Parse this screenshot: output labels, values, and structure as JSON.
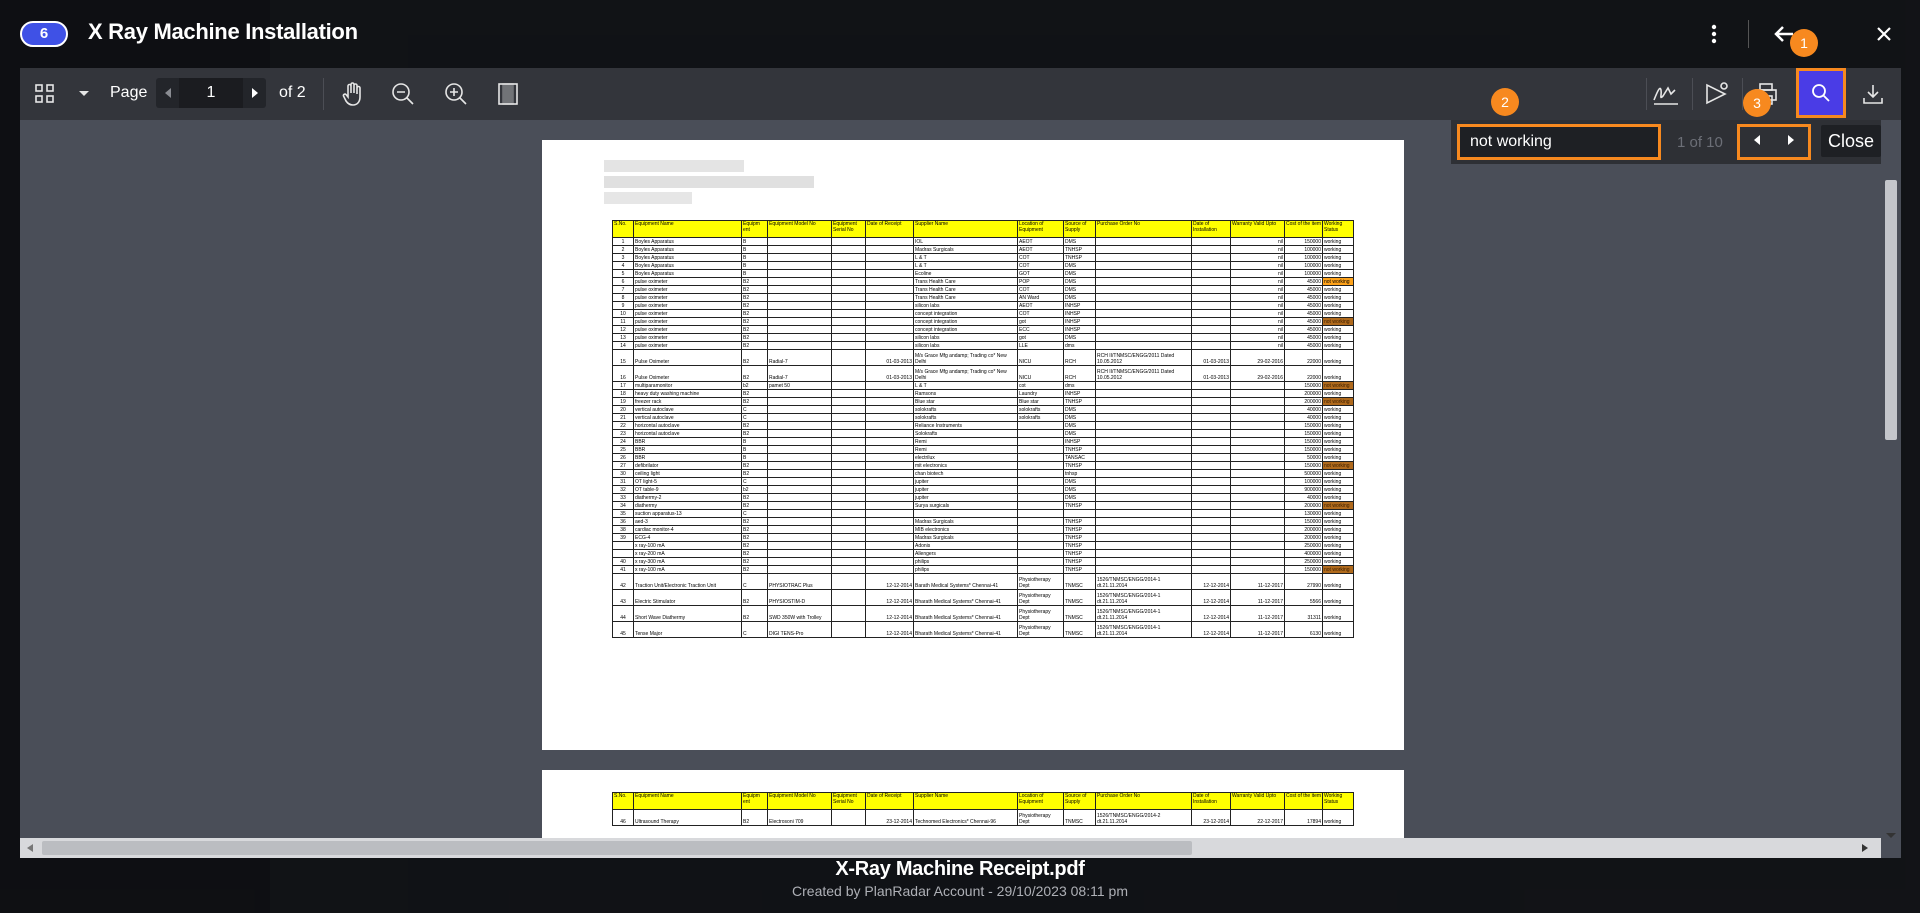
{
  "header": {
    "badge_count": "6",
    "title": "X Ray Machine Installation",
    "menu_icon": "kebab-icon",
    "back_icon": "arrow-left-icon",
    "close_icon": "close-icon"
  },
  "toolbar": {
    "page_label": "Page",
    "current_page": "1",
    "total_pages_label": "of 2",
    "icons": [
      "thumbnails-icon",
      "chevron-down-icon",
      "pan-hand-icon",
      "zoom-out-icon",
      "zoom-in-icon",
      "fit-page-icon",
      "signature-icon",
      "share-icon",
      "print-icon",
      "search-icon",
      "download-icon"
    ]
  },
  "search": {
    "query": "not working",
    "result_count": "1 of 10",
    "close_label": "Close"
  },
  "markers": [
    "1",
    "2",
    "3"
  ],
  "document": {
    "headers": [
      "S.No.",
      "Equipment Name",
      "Equipm ent",
      "Equipment Model No",
      "Equipment Serial No",
      "Date of Receipt",
      "Supplier Name",
      "Location of Equipment",
      "Source of Supply",
      "Purchase Order No",
      "Date of Installation",
      "Warranty Valid Upto",
      "Cost of the item",
      "Working Status"
    ],
    "rows": [
      [
        "1",
        "Boyles Apparatus",
        "B",
        "",
        "",
        "",
        "IOL",
        "AEOT",
        "DMS",
        "",
        "",
        "nil",
        "150000",
        "working"
      ],
      [
        "2",
        "Boyles Apparatus",
        "B",
        "",
        "",
        "",
        "Madras Surgicals",
        "AEOT",
        "TNHSP",
        "",
        "",
        "nil",
        "100000",
        "working"
      ],
      [
        "3",
        "Boyles Apparatus",
        "B",
        "",
        "",
        "",
        "L & T",
        "COT",
        "TNHSP",
        "",
        "",
        "nil",
        "100000",
        "working"
      ],
      [
        "4",
        "Boyles Apparatus",
        "B",
        "",
        "",
        "",
        "L & T",
        "COT",
        "DMS",
        "",
        "",
        "nil",
        "100000",
        "working"
      ],
      [
        "5",
        "Boyles Apparatus",
        "B",
        "",
        "",
        "",
        "Ecoline",
        "GOT",
        "DMS",
        "",
        "",
        "nil",
        "100000",
        "working"
      ],
      [
        "6",
        "pulse oximeter",
        "B2",
        "",
        "",
        "",
        "Trans Health Care",
        "POP",
        "DMS",
        "",
        "",
        "nil",
        "45000",
        "not working"
      ],
      [
        "7",
        "pulse oximeter",
        "B2",
        "",
        "",
        "",
        "Trans Health Care",
        "COT",
        "DMS",
        "",
        "",
        "nil",
        "45000",
        "working"
      ],
      [
        "8",
        "pulse oximeter",
        "B2",
        "",
        "",
        "",
        "Trans Health Care",
        "AN Ward",
        "DMS",
        "",
        "",
        "nil",
        "45000",
        "working"
      ],
      [
        "9",
        "pulse oximeter",
        "B2",
        "",
        "",
        "",
        "silicon labs",
        "AEOT",
        "INHSP",
        "",
        "",
        "nil",
        "45000",
        "working"
      ],
      [
        "10",
        "pulse oximeter",
        "B2",
        "",
        "",
        "",
        "concept integration",
        "COT",
        "INHSP",
        "",
        "",
        "nil",
        "45000",
        "working"
      ],
      [
        "11",
        "pulse oximeter",
        "B2",
        "",
        "",
        "",
        "concept integration",
        "got",
        "INHSP",
        "",
        "",
        "nil",
        "45000",
        "not working"
      ],
      [
        "12",
        "pulse oximeter",
        "B2",
        "",
        "",
        "",
        "concept integration",
        "ECC",
        "INHSP",
        "",
        "",
        "nil",
        "45000",
        "working"
      ],
      [
        "13",
        "pulse oximeter",
        "B2",
        "",
        "",
        "",
        "silicon labs",
        "got",
        "DMS",
        "",
        "",
        "nil",
        "45000",
        "working"
      ],
      [
        "14",
        "pulse oximeter",
        "B2",
        "",
        "",
        "",
        "silicon labs",
        "LLE",
        "dms",
        "",
        "",
        "nil",
        "45000",
        "working"
      ],
      [
        "15",
        "Pulse Oximeter",
        "B2",
        "Radial-7",
        "",
        "01-03-2013",
        "M/s Grace Mfg andamp; Trading co* New Delhi",
        "NICU",
        "RCH",
        "RCH II/TNMSC/ENGG/2011 Dated 10.05.2012",
        "01-03-2013",
        "29-02-2016",
        "22000",
        "working"
      ],
      [
        "16",
        "Pulse Oximeter",
        "B2",
        "Radial-7",
        "",
        "01-03-2013",
        "M/s Grace Mfg andamp; Trading co* New Delhi",
        "NICU",
        "RCH",
        "RCH II/TNMSC/ENGG/2011 Dated 10.05.2012",
        "01-03-2013",
        "29-02-2016",
        "22000",
        "working"
      ],
      [
        "17",
        "multiparamonitor",
        "b2",
        "pamet 50",
        "",
        "",
        "L & T",
        "cot",
        "dms",
        "",
        "",
        "",
        "150000",
        "not working"
      ],
      [
        "18",
        "heavy duty washing machine",
        "B2",
        "",
        "",
        "",
        "Ramsons",
        "Laundry",
        "INHSP",
        "",
        "",
        "",
        "200000",
        "working"
      ],
      [
        "19",
        "freezer rack",
        "B2",
        "",
        "",
        "",
        "Blue star",
        "Blue star",
        "TNHSP",
        "",
        "",
        "",
        "200000",
        "not working"
      ],
      [
        "20",
        "vertical autoclave",
        "C",
        "",
        "",
        "",
        "solokrafts",
        "solokrafts",
        "DMS",
        "",
        "",
        "",
        "40000",
        "working"
      ],
      [
        "21",
        "vertical autoclave",
        "C",
        "",
        "",
        "",
        "solokrafts",
        "solokrafts",
        "DMS",
        "",
        "",
        "",
        "40000",
        "working"
      ],
      [
        "22",
        "horizontal autoclave",
        "B2",
        "",
        "",
        "",
        "Reliance Instruments",
        "",
        "DMS",
        "",
        "",
        "",
        "150000",
        "working"
      ],
      [
        "23",
        "horizontal autoclave",
        "B2",
        "",
        "",
        "",
        "Solokrafts",
        "",
        "DMS",
        "",
        "",
        "",
        "150000",
        "working"
      ],
      [
        "24",
        "BBR",
        "B",
        "",
        "",
        "",
        "Remi",
        "",
        "INHSP",
        "",
        "",
        "",
        "150000",
        "working"
      ],
      [
        "25",
        "BBR",
        "B",
        "",
        "",
        "",
        "Remi",
        "",
        "TNHSP",
        "",
        "",
        "",
        "150000",
        "working"
      ],
      [
        "26",
        "BBR",
        "B",
        "",
        "",
        "",
        "electrilux",
        "",
        "TANSAC",
        "",
        "",
        "",
        "50000",
        "working"
      ],
      [
        "27",
        "defibrilator",
        "B2",
        "",
        "",
        "",
        "mit electronics",
        "",
        "TNHSP",
        "",
        "",
        "",
        "150000",
        "not working"
      ],
      [
        "30",
        "ceiling light",
        "B2",
        "",
        "",
        "",
        "chan biotech",
        "",
        "tnhsp",
        "",
        "",
        "",
        "500000",
        "working"
      ],
      [
        "31",
        "OT light-5",
        "C",
        "",
        "",
        "",
        "jupiter",
        "",
        "DMS",
        "",
        "",
        "",
        "100000",
        "working"
      ],
      [
        "32",
        "OT table-9",
        "b2",
        "",
        "",
        "",
        "jupiter",
        "",
        "DMS",
        "",
        "",
        "",
        "900000",
        "working"
      ],
      [
        "33",
        "diathermy-2",
        "B2",
        "",
        "",
        "",
        "jupiter",
        "",
        "DMS",
        "",
        "",
        "",
        "40000",
        "working"
      ],
      [
        "34",
        "diathermy",
        "B2",
        "",
        "",
        "",
        "Surya surgicals",
        "",
        "TNHSP",
        "",
        "",
        "",
        "200000",
        "not working"
      ],
      [
        "35",
        "suction apparatus-13",
        "C",
        "",
        "",
        "",
        "",
        "",
        "",
        "",
        "",
        "",
        "130000",
        "working"
      ],
      [
        "36",
        "aed-3",
        "B2",
        "",
        "",
        "",
        "Madras Surgicals",
        "",
        "TNHSP",
        "",
        "",
        "",
        "150000",
        "working"
      ],
      [
        "38",
        "cardiac monitor-4",
        "B2",
        "",
        "",
        "",
        "MIB electronics",
        "",
        "TNHSP",
        "",
        "",
        "",
        "200000",
        "working"
      ],
      [
        "39",
        "ECG-4",
        "B2",
        "",
        "",
        "",
        "Madras Surgicals",
        "",
        "TNHSP",
        "",
        "",
        "",
        "200000",
        "working"
      ],
      [
        "",
        "x ray-100 mA",
        "B2",
        "",
        "",
        "",
        "Adonis",
        "",
        "TNHSP",
        "",
        "",
        "",
        "250000",
        "working"
      ],
      [
        "",
        "x ray-200 mA",
        "B2",
        "",
        "",
        "",
        "Allengers",
        "",
        "TNHSP",
        "",
        "",
        "",
        "400000",
        "working"
      ],
      [
        "40",
        "x ray-300 mA",
        "B2",
        "",
        "",
        "",
        "philips",
        "",
        "TNHSP",
        "",
        "",
        "",
        "250000",
        "working"
      ],
      [
        "41",
        "x ray-100 mA",
        "B2",
        "",
        "",
        "",
        "philips",
        "",
        "TNHSP",
        "",
        "",
        "",
        "150000",
        "not working"
      ],
      [
        "42",
        "Traction Unit/Electronic Traction Unit",
        "C",
        "PHYSIOTRAC Plus",
        "",
        "12-12-2014",
        "Barath Medical Systems* Chennai-41",
        "Physiotherapy Dept",
        "TNMSC",
        "1526/TNMSC/ENGG/2014-1 dt.21.11.2014",
        "12-12-2014",
        "11-12-2017",
        "27990",
        "working"
      ],
      [
        "43",
        "Electric Stimulator",
        "B2",
        "PHYSIOSTIM-D",
        "",
        "12-12-2014",
        "Bharath Medical Systems* Chennai-41",
        "Physiotherapy Dept",
        "TNMSC",
        "1526/TNMSC/ENGG/2014-1 dt.21.11.2014",
        "12-12-2014",
        "11-12-2017",
        "5566",
        "working"
      ],
      [
        "44",
        "Short Wave Diathermy",
        "B2",
        "SWD 350W with Trolley",
        "",
        "12-12-2014",
        "Bharath Medical Systems* Chennai-41",
        "Physiotherapy Dept",
        "TNMSC",
        "1526/TNMSC/ENGG/2014-1 dt.21.11.2014",
        "12-12-2014",
        "11-12-2017",
        "31311",
        "working"
      ],
      [
        "45",
        "Tense Major",
        "C",
        "DIGI TENS-Pro",
        "",
        "12-12-2014",
        "Bharath Medical Systems* Chennai-41",
        "Physiotherapy Dept",
        "TNMSC",
        "1526/TNMSC/ENGG/2014-1 dt.21.11.2014",
        "12-12-2014",
        "11-12-2017",
        "6130",
        "working"
      ]
    ],
    "page2_rows": [
      [
        "46",
        "Ultrasound Therapy",
        "B2",
        "Electrosoni 709",
        "",
        "23-12-2014",
        "Technomed Electronics* Chennai-96",
        "Physiotherapy Dept",
        "TNMSC",
        "1526/TNMSC/ENGG/2014-2 dt.21.11.2014",
        "23-12-2014",
        "22-12-2017",
        "17894",
        "working"
      ]
    ]
  },
  "footer": {
    "filename": "X-Ray Machine Receipt.pdf",
    "created_by": "Created by PlanRadar Account - 29/10/2023 08:11 pm"
  },
  "colors": {
    "accent": "#4a3ce6",
    "highlight": "#f7891f",
    "header_yellow": "#ffff00"
  }
}
